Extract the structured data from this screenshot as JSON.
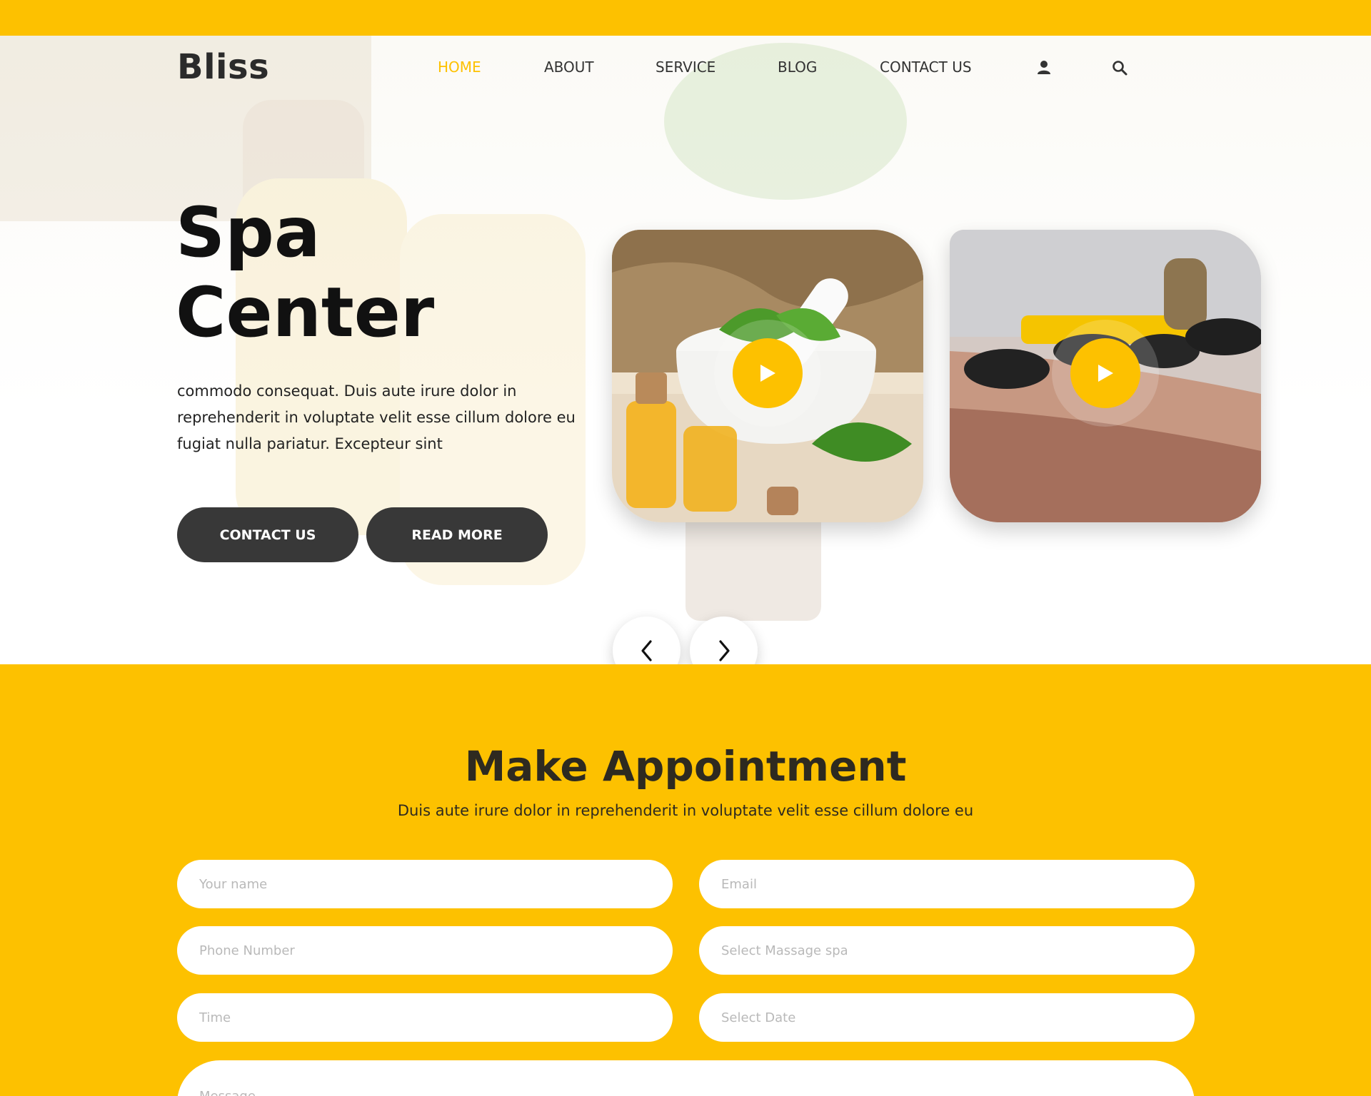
{
  "brand": {
    "logo": "Bliss",
    "accent": "#fdc100",
    "dark": "#383838"
  },
  "nav": {
    "items": [
      {
        "label": "HOME",
        "active": true
      },
      {
        "label": "ABOUT",
        "active": false
      },
      {
        "label": "SERVICE",
        "active": false
      },
      {
        "label": "BLOG",
        "active": false
      },
      {
        "label": "CONTACT US",
        "active": false
      }
    ],
    "icons": [
      "user-icon",
      "search-icon"
    ]
  },
  "hero": {
    "title_line1": "Spa",
    "title_line2": "Center",
    "text": "commodo consequat. Duis aute irure dolor in reprehenderit in voluptate velit esse cillum dolore eu fugiat nulla pariatur. Excepteur sint",
    "contact_button": "CONTACT US",
    "read_more_button": "READ MORE",
    "cards": [
      {
        "icon": "play-icon",
        "image": "essential-oils-mortar-basil-photo"
      },
      {
        "icon": "play-icon",
        "image": "hot-stone-massage-photo"
      }
    ],
    "prev_icon": "chevron-left-icon",
    "next_icon": "chevron-right-icon"
  },
  "appointment": {
    "title": "Make Appointment",
    "subtitle": "Duis aute irure dolor in reprehenderit in voluptate velit esse cillum dolore eu",
    "fields": {
      "name": "Your name",
      "email": "Email",
      "phone": "Phone Number",
      "massage": "Select Massage spa",
      "time": "Time",
      "date": "Select Date",
      "message": "Message"
    }
  }
}
